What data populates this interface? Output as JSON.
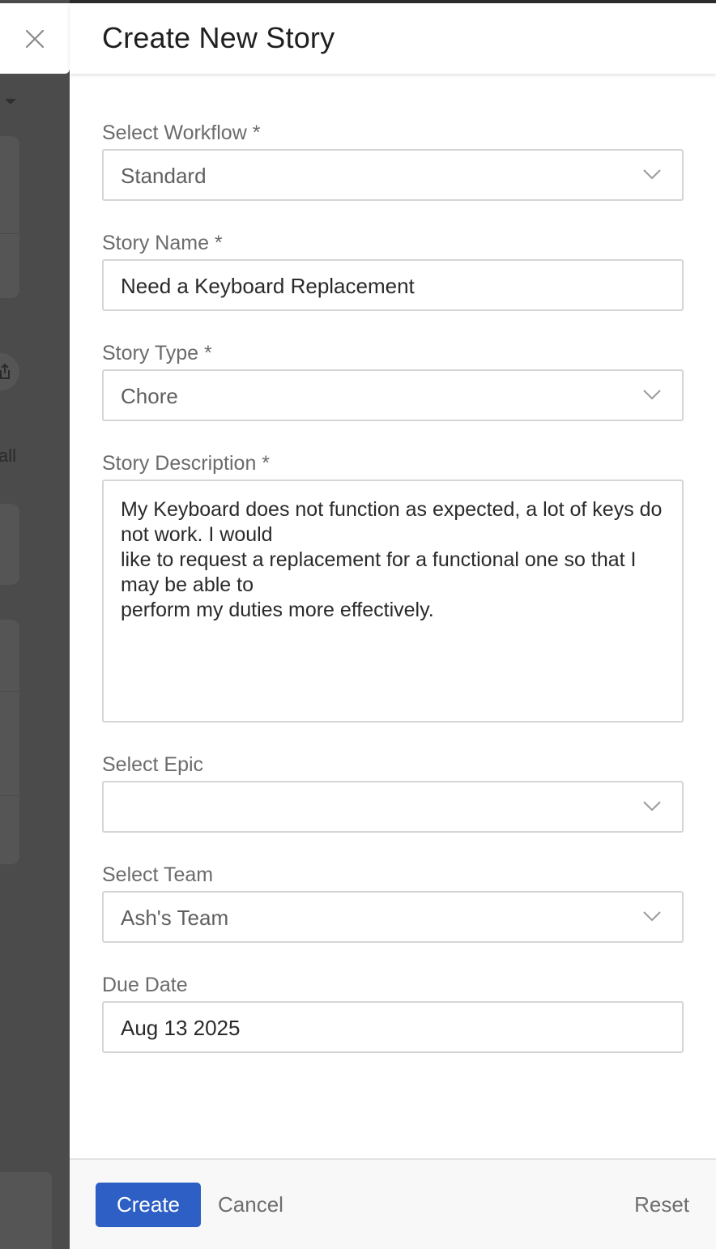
{
  "panel": {
    "title": "Create New Story"
  },
  "backdrop": {
    "partial_text": "all"
  },
  "fields": {
    "workflow": {
      "label": "Select Workflow *",
      "value": "Standard"
    },
    "story_name": {
      "label": "Story Name *",
      "value": "Need a Keyboard Replacement"
    },
    "story_type": {
      "label": "Story Type *",
      "value": "Chore"
    },
    "story_description": {
      "label": "Story Description *",
      "value": "My Keyboard does not function as expected, a lot of keys do not work. I would\nlike to request a replacement for a functional one so that I may be able to\nperform my duties more effectively."
    },
    "epic": {
      "label": "Select Epic",
      "value": ""
    },
    "team": {
      "label": "Select Team",
      "value": "Ash's Team"
    },
    "due_date": {
      "label": "Due Date",
      "value": "Aug 13 2025"
    }
  },
  "footer": {
    "create_label": "Create",
    "cancel_label": "Cancel",
    "reset_label": "Reset"
  },
  "icons": {
    "close": "close-icon",
    "dropdown": "chevron-down-icon",
    "share": "share-icon"
  },
  "colors": {
    "primary": "#2d5fc5",
    "backdrop": "#4b4b4b"
  }
}
